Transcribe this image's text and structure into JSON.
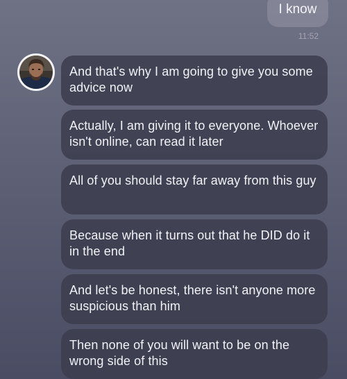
{
  "conversation": {
    "outgoing": {
      "text": "I know",
      "time": "11:52"
    },
    "incoming": {
      "avatar_icon": "profile-photo-avatar",
      "messages": [
        "And that's why I am going to give you some advice now",
        "Actually, I am giving it to everyone. Whoever isn't online, can read it later",
        "All of you should stay far away from this guy",
        "Because when it turns out that he DID do it in the end",
        "And let's be honest, there isn't anyone more suspicious than him",
        "Then none of you will want to be on the wrong side of this"
      ]
    }
  },
  "colors": {
    "background_top": "#6f7184",
    "background_bottom": "#4a4c63",
    "incoming_bubble": "#3c3d4f",
    "outgoing_bubble": "#848698",
    "text": "#f1f2f6",
    "timestamp": "#a5a7b8"
  }
}
